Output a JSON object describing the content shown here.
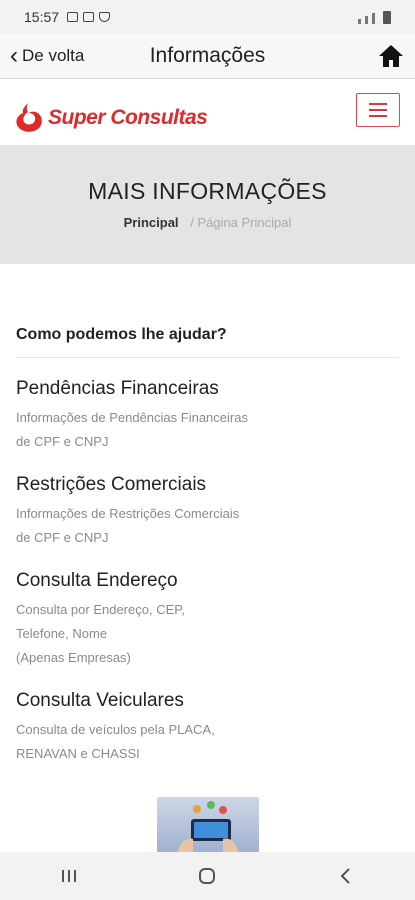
{
  "status_bar": {
    "time": "15:57"
  },
  "app_bar": {
    "back_label": "De volta",
    "title": "Informações"
  },
  "site": {
    "brand": "Super Consultas"
  },
  "banner": {
    "title": "MAIS INFORMAÇÕES",
    "breadcrumb_main": "Principal",
    "breadcrumb_current": "/ Página Principal"
  },
  "content": {
    "question": "Como podemos lhe ajudar?",
    "items": [
      {
        "title": "Pendências Financeiras",
        "desc": "Informações de Pendências Financeiras\nde CPF e CNPJ"
      },
      {
        "title": "Restrições Comerciais",
        "desc": "Informações de Restrições Comerciais\nde CPF e CNPJ"
      },
      {
        "title": "Consulta Endereço",
        "desc": "Consulta por Endereço, CEP,\nTelefone, Nome\n(Apenas Empresas)"
      },
      {
        "title": "Consulta Veiculares",
        "desc": "Consulta de veículos pela PLACA,\nRENAVAN e CHASSI"
      }
    ]
  },
  "colors": {
    "brand_red": "#e02a2a",
    "banner_bg": "#e4e4e4"
  }
}
